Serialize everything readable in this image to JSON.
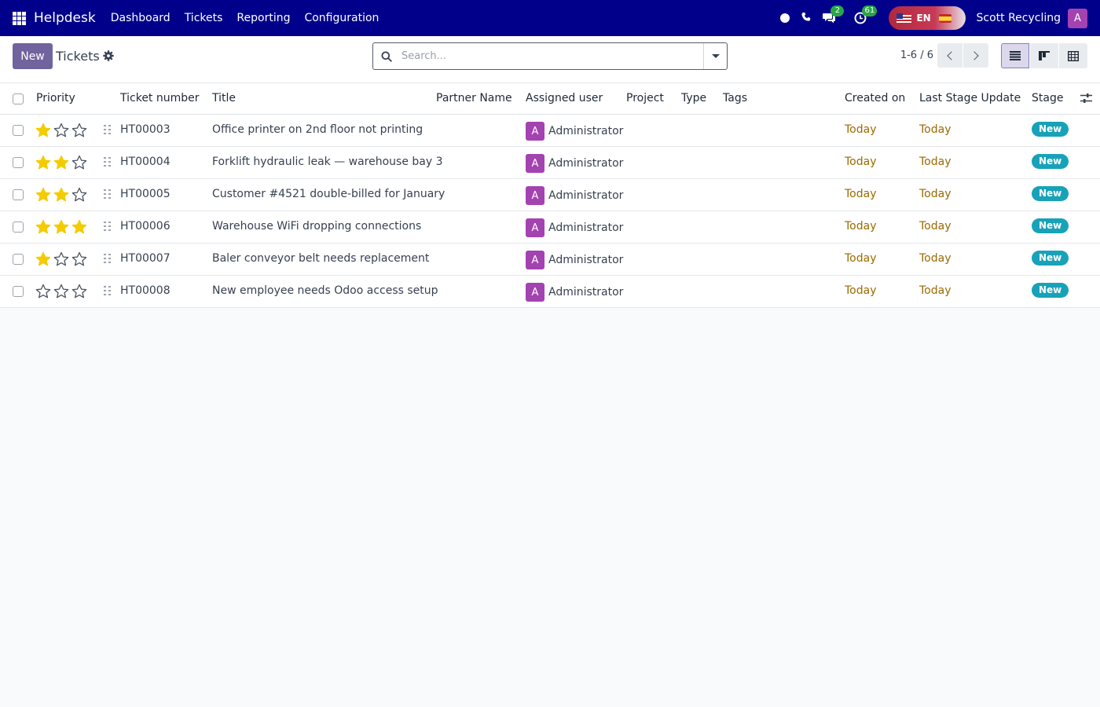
{
  "navbar": {
    "app_name": "Helpdesk",
    "menu": [
      "Dashboard",
      "Tickets",
      "Reporting",
      "Configuration"
    ],
    "messages_count": "2",
    "activities_count": "61",
    "language": "EN",
    "company": "Scott Recycling",
    "user_initial": "A"
  },
  "control_panel": {
    "new_label": "New",
    "breadcrumb": "Tickets",
    "search_placeholder": "Search...",
    "pager": "1-6 / 6"
  },
  "columns": {
    "priority": "Priority",
    "ticket_number": "Ticket number",
    "title": "Title",
    "partner_name": "Partner Name",
    "assigned_user": "Assigned user",
    "project": "Project",
    "type": "Type",
    "tags": "Tags",
    "created_on": "Created on",
    "last_stage_update": "Last Stage Update",
    "stage": "Stage"
  },
  "rows": [
    {
      "priority": 1,
      "ticket_number": "HT00003",
      "title": "Office printer on 2nd floor not printing",
      "assigned_initial": "A",
      "assigned_user": "Administrator",
      "created_on": "Today",
      "last_stage_update": "Today",
      "stage": "New"
    },
    {
      "priority": 2,
      "ticket_number": "HT00004",
      "title": "Forklift hydraulic leak — warehouse bay 3",
      "assigned_initial": "A",
      "assigned_user": "Administrator",
      "created_on": "Today",
      "last_stage_update": "Today",
      "stage": "New"
    },
    {
      "priority": 2,
      "ticket_number": "HT00005",
      "title": "Customer #4521 double-billed for January",
      "assigned_initial": "A",
      "assigned_user": "Administrator",
      "created_on": "Today",
      "last_stage_update": "Today",
      "stage": "New"
    },
    {
      "priority": 3,
      "ticket_number": "HT00006",
      "title": "Warehouse WiFi dropping connections",
      "assigned_initial": "A",
      "assigned_user": "Administrator",
      "created_on": "Today",
      "last_stage_update": "Today",
      "stage": "New"
    },
    {
      "priority": 1,
      "ticket_number": "HT00007",
      "title": "Baler conveyor belt needs replacement",
      "assigned_initial": "A",
      "assigned_user": "Administrator",
      "created_on": "Today",
      "last_stage_update": "Today",
      "stage": "New"
    },
    {
      "priority": 0,
      "ticket_number": "HT00008",
      "title": "New employee needs Odoo access setup",
      "assigned_initial": "A",
      "assigned_user": "Administrator",
      "created_on": "Today",
      "last_stage_update": "Today",
      "stage": "New"
    }
  ],
  "colors": {
    "navbar": "#00008b",
    "primary": "#71639e",
    "star_filled": "#f3cc00",
    "today": "#9c6a00",
    "stage_badge": "#17a2b8",
    "avatar": "#a342b0"
  }
}
